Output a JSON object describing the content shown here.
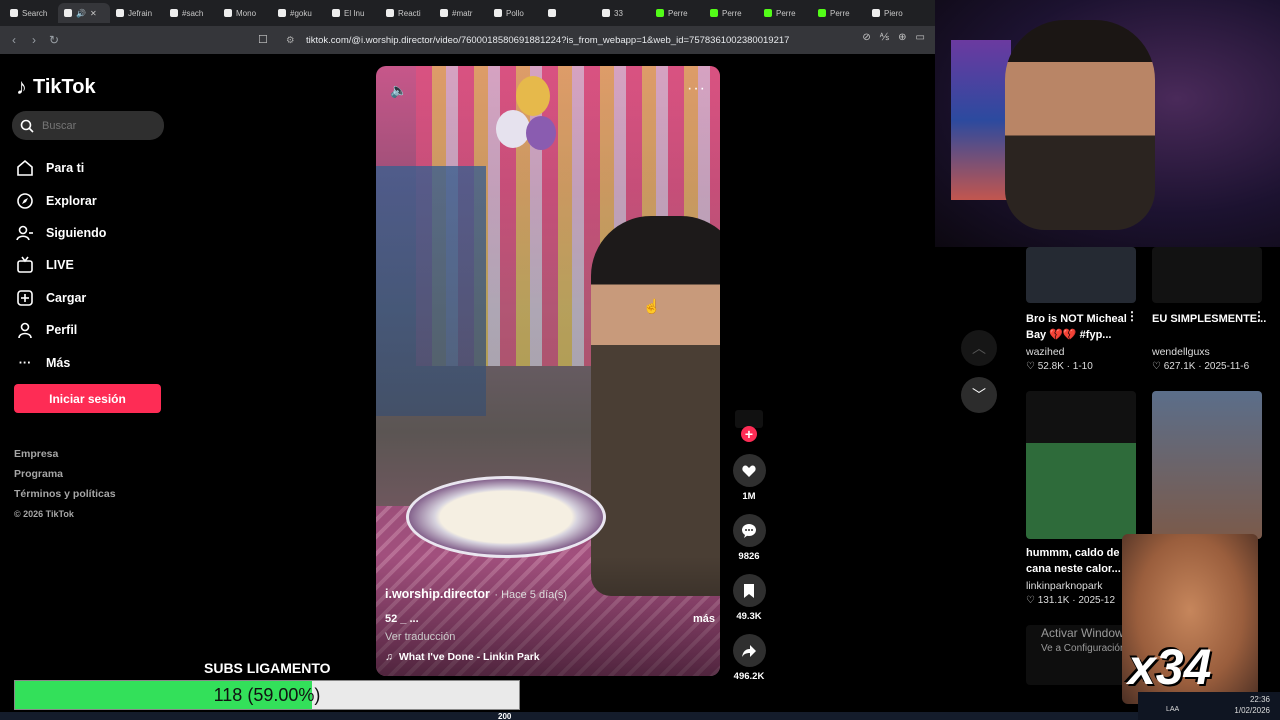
{
  "browser": {
    "tabs": [
      "Search",
      "",
      "Jefrain",
      "#sach",
      "Mono",
      "#goku",
      "El Inu",
      "Reacti",
      "#matr",
      "Pollo",
      "",
      "33",
      "Perre",
      "Perre",
      "Perre",
      "Perre",
      "Piero"
    ],
    "url": "tiktok.com/@i.worship.director/video/7600018580691881224?is_from_webapp=1&web_id=7578361002380019217"
  },
  "sidebar": {
    "logo": "TikTok",
    "search_placeholder": "Buscar",
    "items": [
      {
        "label": "Para ti",
        "icon": "home-icon"
      },
      {
        "label": "Explorar",
        "icon": "compass-icon"
      },
      {
        "label": "Siguiendo",
        "icon": "following-icon"
      },
      {
        "label": "LIVE",
        "icon": "live-icon"
      },
      {
        "label": "Cargar",
        "icon": "upload-icon"
      },
      {
        "label": "Perfil",
        "icon": "profile-icon"
      },
      {
        "label": "Más",
        "icon": "more-icon"
      }
    ],
    "login_label": "Iniciar sesión",
    "footer": [
      "Empresa",
      "Programa",
      "Términos y políticas"
    ],
    "copyright": "© 2026 TikTok"
  },
  "video": {
    "author": "i.worship.director",
    "ago": "· Hace 5 día(s)",
    "desc": "52 _ ...",
    "more": "más",
    "translate": "Ver traducción",
    "song": "What I've Done - Linkin Park"
  },
  "actions": {
    "likes": "1M",
    "comments": "9826",
    "saves": "49.3K",
    "shares": "496.2K"
  },
  "related": [
    {
      "title": "Bro is NOT Micheal Bay 💔💔 #fyp...",
      "user": "wazihed",
      "stats": "52.8K · 1-10"
    },
    {
      "title": "EU SIMPLESMENTE...",
      "user": "wendellguxs",
      "stats": "627.1K · 2025-11-6"
    },
    {
      "title": "hummm, caldo de cana neste calor...",
      "user": "linkinparknopark",
      "stats": "131.1K · 2025-12"
    }
  ],
  "overlay": {
    "watermark_1": "Activar Windows",
    "watermark_2": "Ve a Configuración",
    "meme_text": "x34",
    "subs_label": "SUBS LIGAMENTO",
    "progress_text": "118 (59.00%)",
    "progress_fraction": 0.59,
    "bottom_count": "200"
  },
  "taskbar": {
    "lang": "LAA",
    "time": "22:36",
    "date": "1/02/2026"
  },
  "colors": {
    "accent": "#fe2c55",
    "progress": "#33e05a"
  }
}
